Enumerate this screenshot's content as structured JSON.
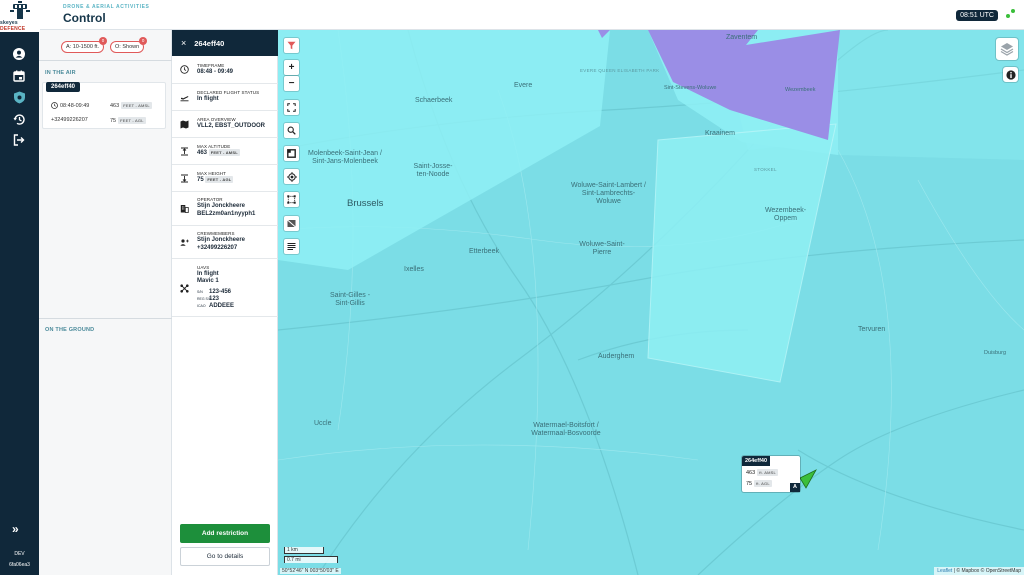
{
  "header": {
    "brand": "skeyes",
    "brand_sub": "DEFENCE",
    "subtitle": "DRONE & AERIAL ACTIVITIES",
    "title": "Control",
    "clock": "08:51 UTC"
  },
  "rail": {
    "items": [
      "account-icon",
      "calendar-icon",
      "drone-shield-icon",
      "history-icon",
      "logout-icon"
    ],
    "expand": "»",
    "env": "DEV",
    "version": "6fa06ea3"
  },
  "filters": {
    "altitude": {
      "label": "A: 10-1500 ft.",
      "badge": "0"
    },
    "shown": {
      "label": "O: Shown",
      "badge": "0"
    }
  },
  "list": {
    "in_the_air": "IN THE AIR",
    "on_the_ground": "ON THE GROUND",
    "flight": {
      "id": "264eff40",
      "time": "08:48-09:49",
      "phone": "+32499226207",
      "altitude": "463",
      "altitude_unit": "FEET - AMSL",
      "height": "75",
      "height_unit": "FEET - AGL"
    }
  },
  "detail": {
    "close": "×",
    "id": "264eff40",
    "rows": [
      {
        "label": "TIMEFRAME",
        "value": "08:48 - 09:49"
      },
      {
        "label": "DECLARED FLIGHT STATUS",
        "value": "In flight"
      },
      {
        "label": "AREA OVERVIEW",
        "value": "VLL2, EBST_OUTDOOR"
      },
      {
        "label": "MAX ALTITUDE",
        "value": "463",
        "unit": "FEET - AMSL"
      },
      {
        "label": "MAX HEIGHT",
        "value": "75",
        "unit": "FEET - AGL"
      },
      {
        "label": "OPERATOR",
        "value": "Stijn Jonckheere",
        "value2": "BEL2zm0an1nyyph1"
      },
      {
        "label": "CREWMEMBERS",
        "value": "Stijn Jonckheere",
        "value2": "+32499226207"
      },
      {
        "label": "UAVS",
        "value": "In flight",
        "value2": "Mavic 1"
      }
    ],
    "uav": {
      "sn_label": "S/N",
      "sn": "123-456",
      "reg_label": "REG S/N",
      "reg": "123",
      "icao_label": "ICAO",
      "icao": "ADDEEE"
    },
    "add_restriction": "Add restriction",
    "go_to_details": "Go to details"
  },
  "map": {
    "zoom_in": "+",
    "zoom_out": "−",
    "places": [
      "Zaventem",
      "Evere",
      "Schaerbeek",
      "Evere Queen Elisabeth Park",
      "Sint-Stevens-Woluwe",
      "Wezembeek",
      "Kraainem",
      "Stokkel",
      "Molenbeek-Saint-Jean / Sint-Jans-Molenbeek",
      "Saint-Josse-ten-Noode",
      "Woluwe-Saint-Lambert / Sint-Lambrechts-Woluwe",
      "Brussels",
      "Wezembeek-Oppem",
      "Etterbeek",
      "Woluwe-Saint-Pierre",
      "Ixelles",
      "Saint-Gilles - Sint-Gillis",
      "Tervuren",
      "Auderghem",
      "Watermael-Boitsfort / Watermaal-Bosvoorde",
      "Uccle",
      "Duisburg"
    ],
    "scale_km": "1 km",
    "scale_mi": "0.7 mi",
    "coords": "50°52'46\" N 003°50'03\" E",
    "attribution_leaflet": "Leaflet",
    "attribution_rest": " | © Mapbox © OpenStreetMap",
    "popup": {
      "id": "264eff40",
      "altitude": "463",
      "altitude_unit": "ft. AMSL",
      "height": "75",
      "height_unit": "ft. AGL",
      "badge": "A"
    }
  },
  "colors": {
    "navy": "#10283a",
    "accent": "#5ab4c4",
    "map_water": "#7bdde6",
    "zone_cyan": "#8ff0f4",
    "zone_purple": "#9a8ee6",
    "alert": "#e05a5a",
    "green": "#1d8f3b"
  }
}
